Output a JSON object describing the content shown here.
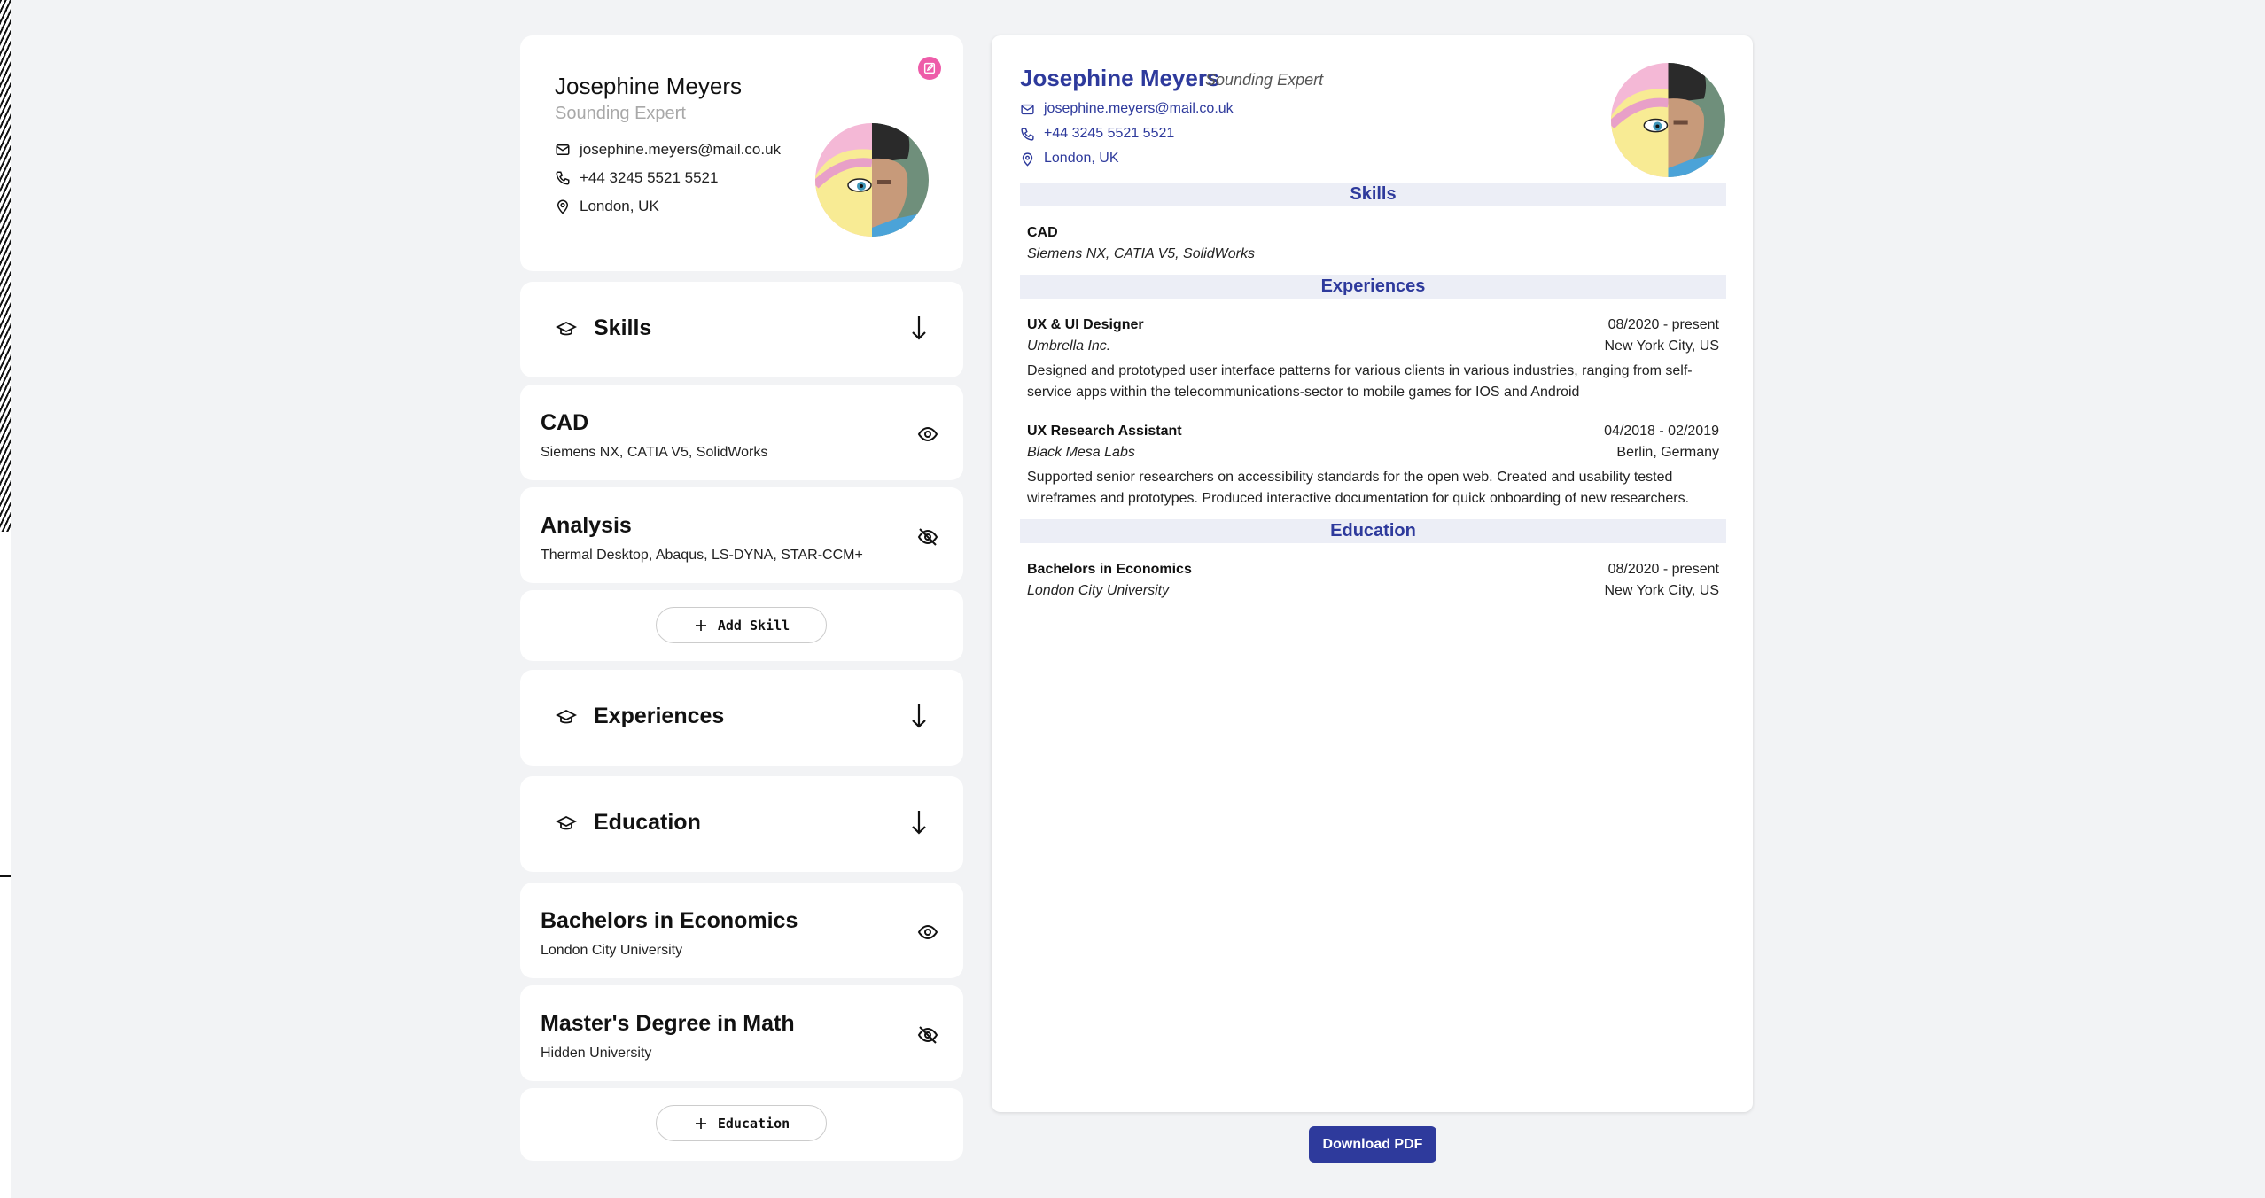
{
  "profile": {
    "name": "Josephine Meyers",
    "title": "Sounding Expert",
    "email": "josephine.meyers@mail.co.uk",
    "phone": "+44 3245 5521 5521",
    "location": "London, UK"
  },
  "sections": {
    "skills": "Skills",
    "experiences": "Experiences",
    "education": "Education"
  },
  "skills": [
    {
      "title": "CAD",
      "subtitle": "Siemens NX, CATIA V5, SolidWorks",
      "visibility": "visible"
    },
    {
      "title": "Analysis",
      "subtitle": "Thermal Desktop, Abaqus, LS-DYNA, STAR-CCM+",
      "visibility": "hidden"
    }
  ],
  "add_skill_label": "Add Skill",
  "education": [
    {
      "title": "Bachelors in Economics",
      "subtitle": "London City University",
      "visibility": "visible"
    },
    {
      "title": "Master's Degree in Math",
      "subtitle": "Hidden University",
      "visibility": "hidden"
    }
  ],
  "add_education_label": "Education",
  "preview": {
    "skills_heading": "Skills",
    "skill": {
      "name": "CAD",
      "tools": "Siemens NX, CATIA V5, SolidWorks"
    },
    "experiences_heading": "Experiences",
    "experiences": [
      {
        "role": "UX & UI Designer",
        "company": "Umbrella Inc.",
        "dates": "08/2020 - present",
        "location": "New York City, US",
        "description": "Designed and prototyped user interface patterns for various clients in various industries, ranging from self-service apps within the telecommunications-sector to mobile games for IOS and Android"
      },
      {
        "role": "UX Research Assistant",
        "company": "Black Mesa Labs",
        "dates": "04/2018 - 02/2019",
        "location": "Berlin, Germany",
        "description": "Supported senior researchers on accessibility standards for the open web. Created and usability tested wireframes and prototypes. Produced interactive documentation for quick onboarding of new researchers."
      }
    ],
    "education_heading": "Education",
    "education": {
      "degree": "Bachelors in Economics",
      "school": "London City University",
      "dates": "08/2020 - present",
      "location": "New York City, US"
    }
  },
  "download_label": "Download PDF",
  "icons": {
    "edit": "edit-icon",
    "mail": "mail-icon",
    "phone": "phone-icon",
    "location": "map-pin-icon",
    "section": "graduation-cap-icon",
    "expand": "arrow-down-icon",
    "visible": "eye-icon",
    "hidden": "eye-off-icon",
    "add": "plus-icon"
  },
  "colors": {
    "accent": "#2e3a9c",
    "edit_button": "#ee5ca9",
    "band": "#eceef6",
    "background": "#f2f3f5"
  }
}
